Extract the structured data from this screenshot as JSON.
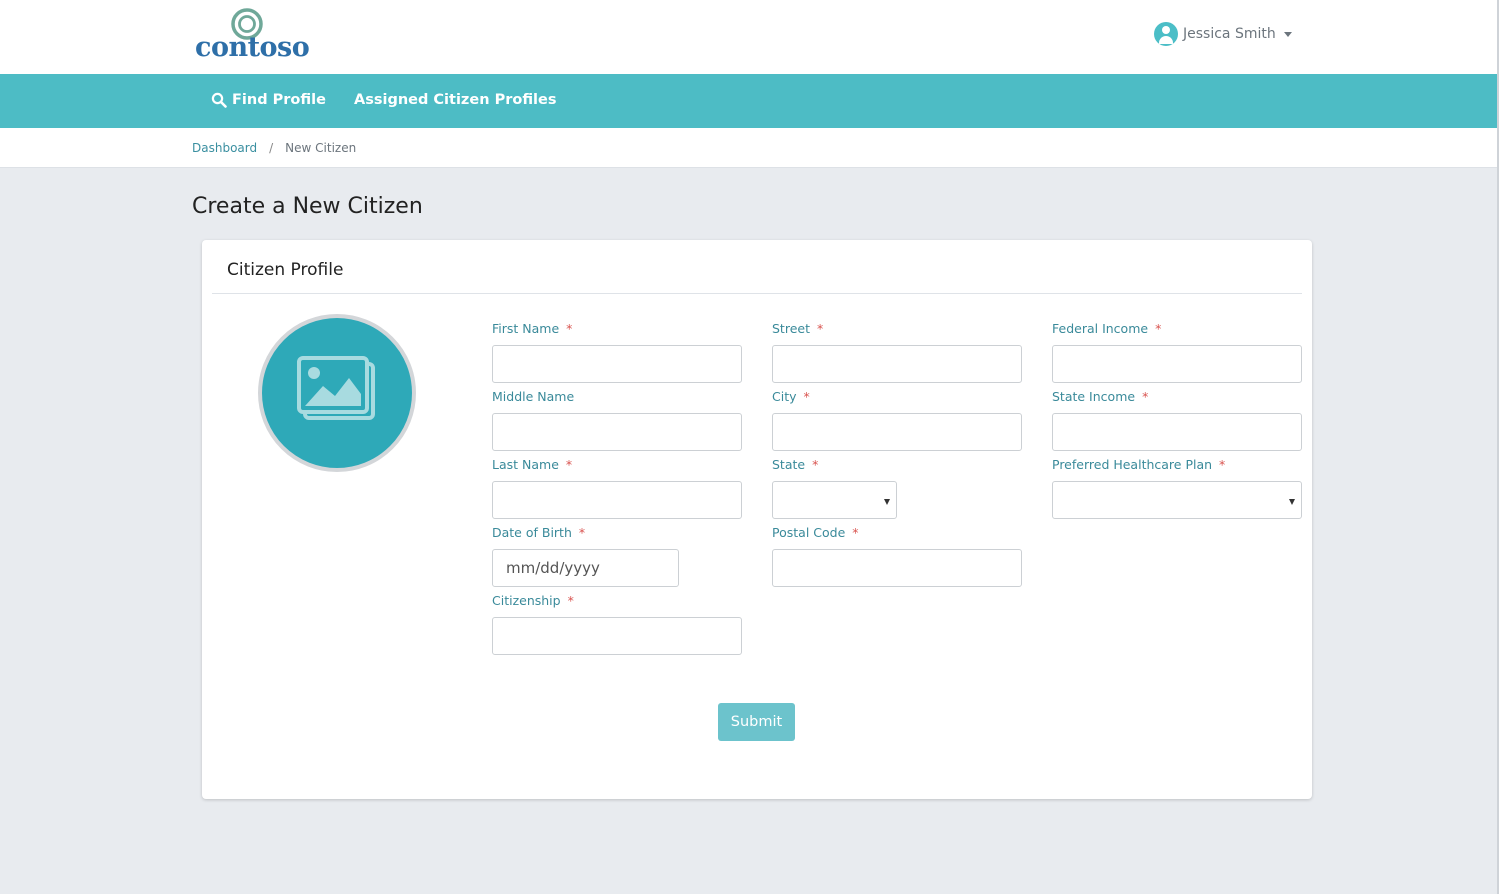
{
  "header": {
    "logo_text": "contoso",
    "user_name": "Jessica Smith"
  },
  "nav": {
    "items": [
      {
        "label": "Find Profile",
        "icon": "search-icon"
      },
      {
        "label": "Assigned Citizen Profiles"
      }
    ]
  },
  "breadcrumb": {
    "items": [
      "Dashboard",
      "New Citizen"
    ],
    "separator": "/"
  },
  "page": {
    "title": "Create a New Citizen"
  },
  "card": {
    "title": "Citizen Profile",
    "photo_icon": "image-placeholder-icon"
  },
  "form": {
    "first_name": {
      "label": "First Name",
      "required": "*",
      "value": ""
    },
    "middle_name": {
      "label": "Middle Name",
      "value": ""
    },
    "last_name": {
      "label": "Last Name",
      "required": "*",
      "value": ""
    },
    "dob": {
      "label": "Date of Birth",
      "required": "*",
      "placeholder": "mm/dd/yyyy"
    },
    "citizenship": {
      "label": "Citizenship",
      "required": "*",
      "value": ""
    },
    "street": {
      "label": "Street",
      "required": "*",
      "value": ""
    },
    "city": {
      "label": "City",
      "required": "*",
      "value": ""
    },
    "state": {
      "label": "State",
      "required": "*",
      "selected": ""
    },
    "postal_code": {
      "label": "Postal Code",
      "required": "*",
      "value": ""
    },
    "federal_income": {
      "label": "Federal Income",
      "required": "*",
      "value": ""
    },
    "state_income": {
      "label": "State Income",
      "required": "*",
      "value": ""
    },
    "healthcare_plan": {
      "label": "Preferred Healthcare Plan",
      "required": "*",
      "selected": ""
    },
    "submit_label": "Submit"
  },
  "colors": {
    "nav_background": "#4dbcc5",
    "accent": "#2ea9b8",
    "label": "#3a8a9a",
    "required": "#d9534f",
    "submit": "#6cc3cc"
  }
}
